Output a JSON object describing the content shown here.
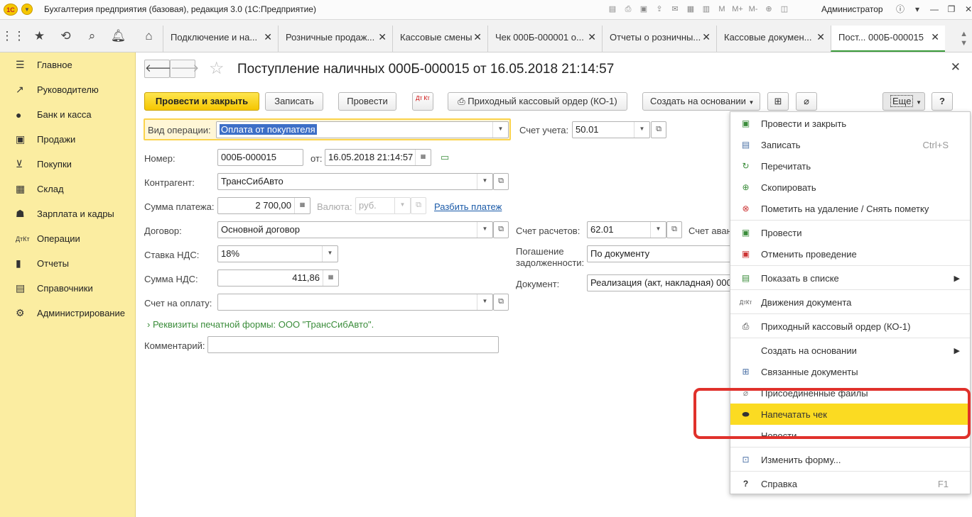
{
  "titlebar": {
    "title": "Бухгалтерия предприятия (базовая), редакция 3.0  (1С:Предприятие)",
    "logo": "1С",
    "user": "Администратор"
  },
  "tabs": [
    {
      "label": "Подключение и на..."
    },
    {
      "label": "Розничные продаж..."
    },
    {
      "label": "Кассовые смены"
    },
    {
      "label": "Чек 000Б-000001 о..."
    },
    {
      "label": "Отчеты о розничны..."
    },
    {
      "label": "Кассовые докумен..."
    },
    {
      "label": "Пост...      000Б-000015"
    }
  ],
  "sidebar": {
    "items": [
      {
        "label": "Главное",
        "icon": "menu-icon"
      },
      {
        "label": "Руководителю",
        "icon": "chart-icon"
      },
      {
        "label": "Банк и касса",
        "icon": "bank-icon"
      },
      {
        "label": "Продажи",
        "icon": "bag-icon"
      },
      {
        "label": "Покупки",
        "icon": "cart-icon"
      },
      {
        "label": "Склад",
        "icon": "warehouse-icon"
      },
      {
        "label": "Зарплата и кадры",
        "icon": "person-icon"
      },
      {
        "label": "Операции",
        "icon": "dtkt-icon"
      },
      {
        "label": "Отчеты",
        "icon": "bars-icon"
      },
      {
        "label": "Справочники",
        "icon": "book-icon"
      },
      {
        "label": "Администрирование",
        "icon": "gear-icon"
      }
    ]
  },
  "document": {
    "title": "Поступление наличных 000Б-000015 от 16.05.2018 21:14:57"
  },
  "toolbar": {
    "post_close": "Провести и закрыть",
    "save": "Записать",
    "post": "Провести",
    "dtkt": "Дт Кт",
    "print_order": "Приходный кассовый ордер (КО-1)",
    "create_based": "Создать на основании",
    "more": "Еще",
    "help": "?"
  },
  "form": {
    "operation_label": "Вид операции:",
    "operation_value": "Оплата от покупателя",
    "account_label": "Счет учета:",
    "account_value": "50.01",
    "number_label": "Номер:",
    "number_value": "000Б-000015",
    "date_label": "от:",
    "date_value": "16.05.2018 21:14:57",
    "counterparty_label": "Контрагент:",
    "counterparty_value": "ТрансСибАвто",
    "amount_label": "Сумма платежа:",
    "amount_value": "2 700,00",
    "currency_label": "Валюта:",
    "currency_value": "руб.",
    "split_link": "Разбить платеж",
    "contract_label": "Договор:",
    "contract_value": "Основной договор",
    "settle_label": "Счет расчетов:",
    "settle_value": "62.01",
    "advance_label": "Счет аван",
    "vat_rate_label": "Ставка НДС:",
    "vat_rate_value": "18%",
    "repay_label": "Погашение задолженности:",
    "repay_value": "По документу",
    "vat_amount_label": "Сумма НДС:",
    "vat_amount_value": "411,86",
    "doc_label": "Документ:",
    "doc_value": "Реализация (акт, накладная) 000",
    "invoice_label": "Счет на оплату:",
    "invoice_value": "",
    "print_details": "Реквизиты печатной формы: ООО \"ТрансСибАвто\".",
    "comment_label": "Комментарий:",
    "comment_value": ""
  },
  "menu": {
    "items": [
      {
        "label": "Провести и закрыть",
        "shortcut": "",
        "icon": "post-close-icon"
      },
      {
        "label": "Записать",
        "shortcut": "Ctrl+S",
        "icon": "save-icon"
      },
      {
        "label": "Перечитать",
        "shortcut": "",
        "icon": "refresh-icon"
      },
      {
        "label": "Скопировать",
        "shortcut": "",
        "icon": "copy-icon"
      },
      {
        "label": "Пометить на удаление / Снять пометку",
        "shortcut": "",
        "icon": "delete-mark-icon"
      },
      {
        "label": "Провести",
        "shortcut": "",
        "icon": "post-icon"
      },
      {
        "label": "Отменить проведение",
        "shortcut": "",
        "icon": "unpost-icon"
      },
      {
        "label": "Показать в списке",
        "shortcut": "",
        "icon": "list-icon"
      },
      {
        "label": "Движения документа",
        "shortcut": "",
        "icon": "dtkt-icon"
      },
      {
        "label": "Приходный кассовый ордер (КО-1)",
        "shortcut": "",
        "icon": "print-icon"
      },
      {
        "label": "Создать на основании",
        "shortcut": "",
        "icon": ""
      },
      {
        "label": "Связанные документы",
        "shortcut": "",
        "icon": "related-docs-icon"
      },
      {
        "label": "Присоединенные файлы",
        "shortcut": "",
        "icon": "paperclip-icon"
      },
      {
        "label": "Напечатать чек",
        "shortcut": "",
        "icon": "receipt-printer-icon"
      },
      {
        "label": "Новости",
        "shortcut": "",
        "icon": ""
      },
      {
        "label": "Изменить форму...",
        "shortcut": "",
        "icon": "form-settings-icon"
      },
      {
        "label": "Справка",
        "shortcut": "F1",
        "icon": "help-icon"
      }
    ]
  },
  "colors": {
    "accent": "#fbdb22",
    "sidebar": "#fbeda1",
    "highlight_box": "#e0312b",
    "link": "#1a5aa8"
  }
}
